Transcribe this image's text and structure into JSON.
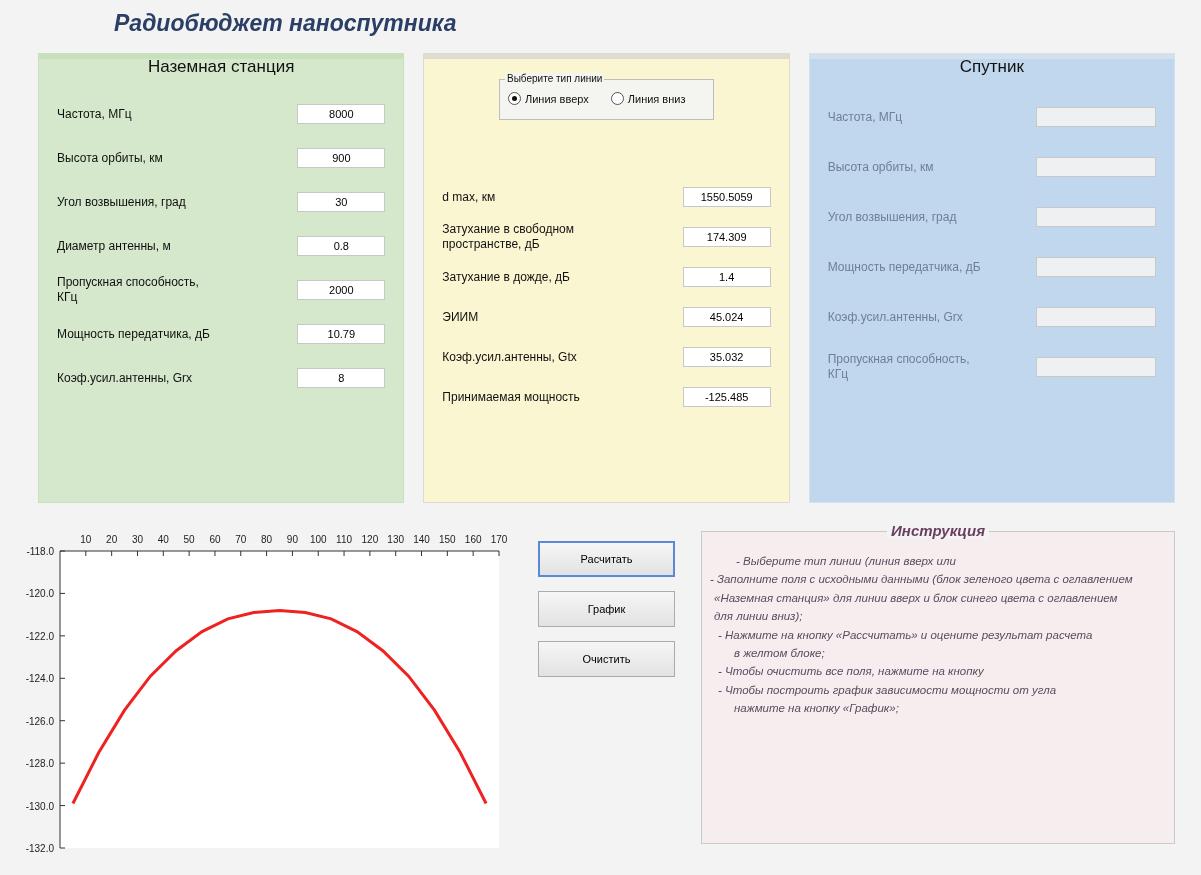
{
  "title": "Радиобюджет наноспутника",
  "ground_station": {
    "title": "Наземная станция",
    "fields": [
      {
        "label": "Частота, МГц",
        "value": "8000"
      },
      {
        "label": "Высота орбиты, км",
        "value": "900"
      },
      {
        "label": "Угол возвышения, град",
        "value": "30"
      },
      {
        "label": "Диаметр антенны, м",
        "value": "0.8"
      },
      {
        "label": "Пропускная способность, КГц",
        "value": "2000"
      },
      {
        "label": "Мощность передатчика, дБ",
        "value": "10.79"
      },
      {
        "label": "Коэф.усил.антенны, Grx",
        "value": "8"
      }
    ]
  },
  "results": {
    "line_type": {
      "title": "Выберите тип линии",
      "options": [
        {
          "label": "Линия вверх",
          "selected": true
        },
        {
          "label": "Линия вниз",
          "selected": false
        }
      ]
    },
    "fields": [
      {
        "label": "d max, км",
        "value": "1550.5059"
      },
      {
        "label": "Затухание в свободном пространстве, дБ",
        "value": "174.309"
      },
      {
        "label": "Затухание в дожде, дБ",
        "value": "1.4"
      },
      {
        "label": "ЭИИМ",
        "value": "45.024"
      },
      {
        "label": "Коэф.усил.антенны, Gtx",
        "value": "35.032"
      },
      {
        "label": "Принимаемая мощность",
        "value": "-125.485"
      }
    ]
  },
  "satellite": {
    "title": "Спутник",
    "disabled": true,
    "fields": [
      {
        "label": "Частота, МГц"
      },
      {
        "label": "Высота орбиты, км"
      },
      {
        "label": "Угол возвышения, град"
      },
      {
        "label": "Мощность передатчика, дБ"
      },
      {
        "label": "Коэф.усил.антенны, Grx"
      },
      {
        "label": "Пропускная способность, КГц"
      }
    ]
  },
  "chart_data": {
    "type": "line",
    "x": [
      5,
      15,
      25,
      35,
      45,
      55,
      65,
      75,
      85,
      95,
      105,
      115,
      125,
      135,
      145,
      155,
      165
    ],
    "series": [
      {
        "color": "#ee2222",
        "values": [
          -129.9,
          -127.5,
          -125.5,
          -123.9,
          -122.7,
          -121.8,
          -121.2,
          -120.9,
          -120.8,
          -120.9,
          -121.2,
          -121.8,
          -122.7,
          -123.9,
          -125.5,
          -127.5,
          -129.9
        ]
      }
    ],
    "xlim": [
      0,
      170
    ],
    "ylim": [
      -132,
      -118
    ],
    "xticks": [
      10,
      20,
      30,
      40,
      50,
      60,
      70,
      80,
      90,
      100,
      110,
      120,
      130,
      140,
      150,
      160,
      170
    ],
    "yticks": [
      {
        "value": -118,
        "label": "-118.0"
      },
      {
        "value": -120,
        "label": "-120.0"
      },
      {
        "value": -122,
        "label": "-122.0"
      },
      {
        "value": -124,
        "label": "-124.0"
      },
      {
        "value": -126,
        "label": "-126.0"
      },
      {
        "value": -128,
        "label": "-128.0"
      },
      {
        "value": -130,
        "label": "-130.0"
      },
      {
        "value": -132,
        "label": "-132.0"
      }
    ]
  },
  "buttons": [
    {
      "label": "Расчитать",
      "focused": true
    },
    {
      "label": "График",
      "focused": false
    },
    {
      "label": "Очистить",
      "focused": false
    }
  ],
  "instructions": {
    "title": "Инструкция",
    "lines": [
      "- Выберите тип линии (линия вверх или",
      "- Заполните поля с исходными данными (блок зеленого цвета с оглавлением",
      "«Наземная станция» для линии вверх и блок синего цвета с оглавлением",
      "для линии вниз);",
      "- Нажмите на кнопку «Рассчитать» и оцените результат расчета",
      "в желтом блоке;",
      "- Чтобы очистить все поля, нажмите на кнопку",
      "- Чтобы построить график зависимости мощности от угла",
      "нажмите на кнопку «График»;"
    ]
  }
}
